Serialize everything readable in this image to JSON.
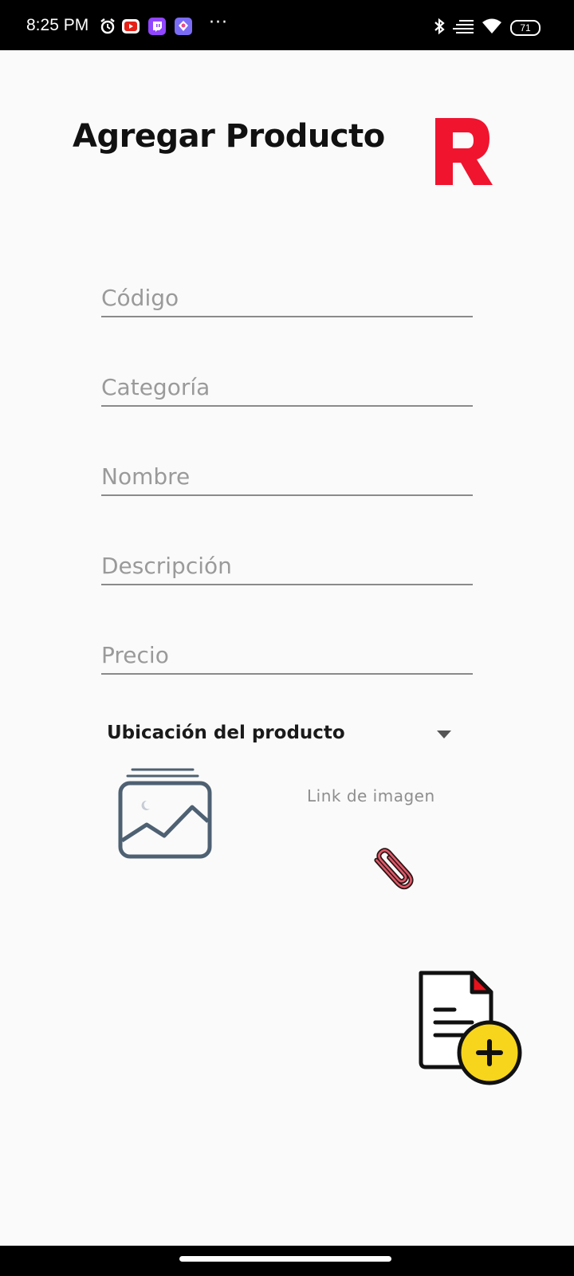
{
  "status_bar": {
    "time": "8:25 PM",
    "battery": "71",
    "notification_icons": [
      "alarm-icon",
      "youtube-icon",
      "twitch-icon",
      "app-icon"
    ],
    "more": "···",
    "system_icons": [
      "bluetooth-icon",
      "vibrate-icon",
      "wifi-icon",
      "battery-icon"
    ]
  },
  "header": {
    "title": "Agregar Producto",
    "logo_color": "#f0142f"
  },
  "form": {
    "codigo": {
      "placeholder": "Código",
      "value": ""
    },
    "categoria": {
      "placeholder": "Categoría",
      "value": ""
    },
    "nombre": {
      "placeholder": "Nombre",
      "value": ""
    },
    "descripcion": {
      "placeholder": "Descripción",
      "value": ""
    },
    "precio": {
      "placeholder": "Precio",
      "value": ""
    },
    "ubicacion": {
      "selected": "Ubicación del producto"
    }
  },
  "image": {
    "link_label": "Link de imagen",
    "placeholder_icon": "image-icon",
    "attach_icon": "paperclip-icon"
  },
  "actions": {
    "add_icon": "add-document-icon",
    "accent_yellow": "#f7d51c",
    "accent_red": "#e8111c"
  }
}
